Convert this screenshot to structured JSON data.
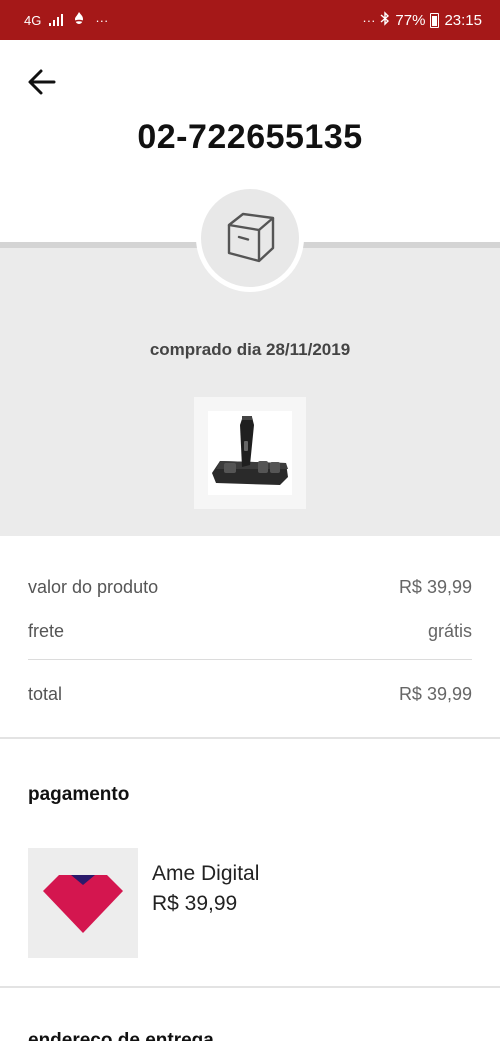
{
  "status_bar": {
    "network": "4G",
    "notification_icon": "santander-flame-icon",
    "more_left": "···",
    "more_right": "···",
    "battery": "77%",
    "time": "23:15",
    "colors": {
      "background": "#a51818"
    }
  },
  "header": {
    "back_icon": "back-arrow-icon",
    "order_number": "02-722655135"
  },
  "summary": {
    "status_icon": "box-icon",
    "purchase_date": "comprado dia 28/11/2019",
    "product_image": "hair-trimmer-kit-photo"
  },
  "prices": {
    "product_label": "valor do produto",
    "product_value": "R$ 39,99",
    "shipping_label": "frete",
    "shipping_value": "grátis",
    "total_label": "total",
    "total_value": "R$ 39,99"
  },
  "payment": {
    "title": "pagamento",
    "method_name": "Ame Digital",
    "method_amount": "R$ 39,99",
    "logo_colors": {
      "heart": "#d4164f",
      "top": "#2b1a6b"
    }
  },
  "delivery": {
    "title": "endereço de entrega"
  }
}
